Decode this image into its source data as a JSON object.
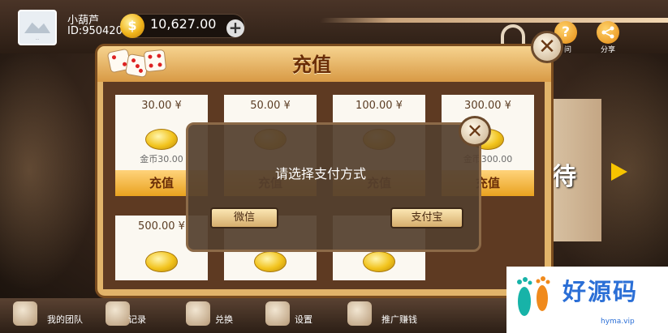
{
  "header": {
    "username": "小葫芦",
    "user_id": "ID:950420",
    "balance": "10,627.00",
    "plus_label": "+",
    "coin_symbol": "$",
    "help_label": "问",
    "share_label": "分享"
  },
  "recharge_panel": {
    "title": "充值",
    "close_label": "✕",
    "cards_row1": [
      {
        "price": "30.00 ¥",
        "gold": "金币30.00",
        "button": "充值"
      },
      {
        "price": "50.00 ¥",
        "gold": "",
        "button": "充值"
      },
      {
        "price": "100.00 ¥",
        "gold": "",
        "button": "充值"
      },
      {
        "price": "300.00 ¥",
        "gold": "金币300.00",
        "button": "充值"
      }
    ],
    "cards_row2": [
      {
        "price": "500.00 ¥"
      },
      {
        "price": ""
      },
      {
        "price": ""
      }
    ]
  },
  "payment_dialog": {
    "message": "请选择支付方式",
    "wechat_label": "微信",
    "alipay_label": "支付宝",
    "close_label": "✕"
  },
  "side": {
    "text": "待"
  },
  "bottom_nav": [
    {
      "label": "我的团队",
      "icon": "team-icon"
    },
    {
      "label": "记录",
      "icon": "trophy-icon"
    },
    {
      "label": "兑换",
      "icon": "coins-icon"
    },
    {
      "label": "设置",
      "icon": "gear-icon"
    },
    {
      "label": "推广赚钱",
      "icon": "promote-icon"
    }
  ],
  "watermark": {
    "text": "好源码",
    "url": "hyma.vip"
  },
  "colors": {
    "accent_gold": "#e9a21f",
    "panel_title": "#6a2d07",
    "watermark_blue": "#2b6fd6"
  }
}
